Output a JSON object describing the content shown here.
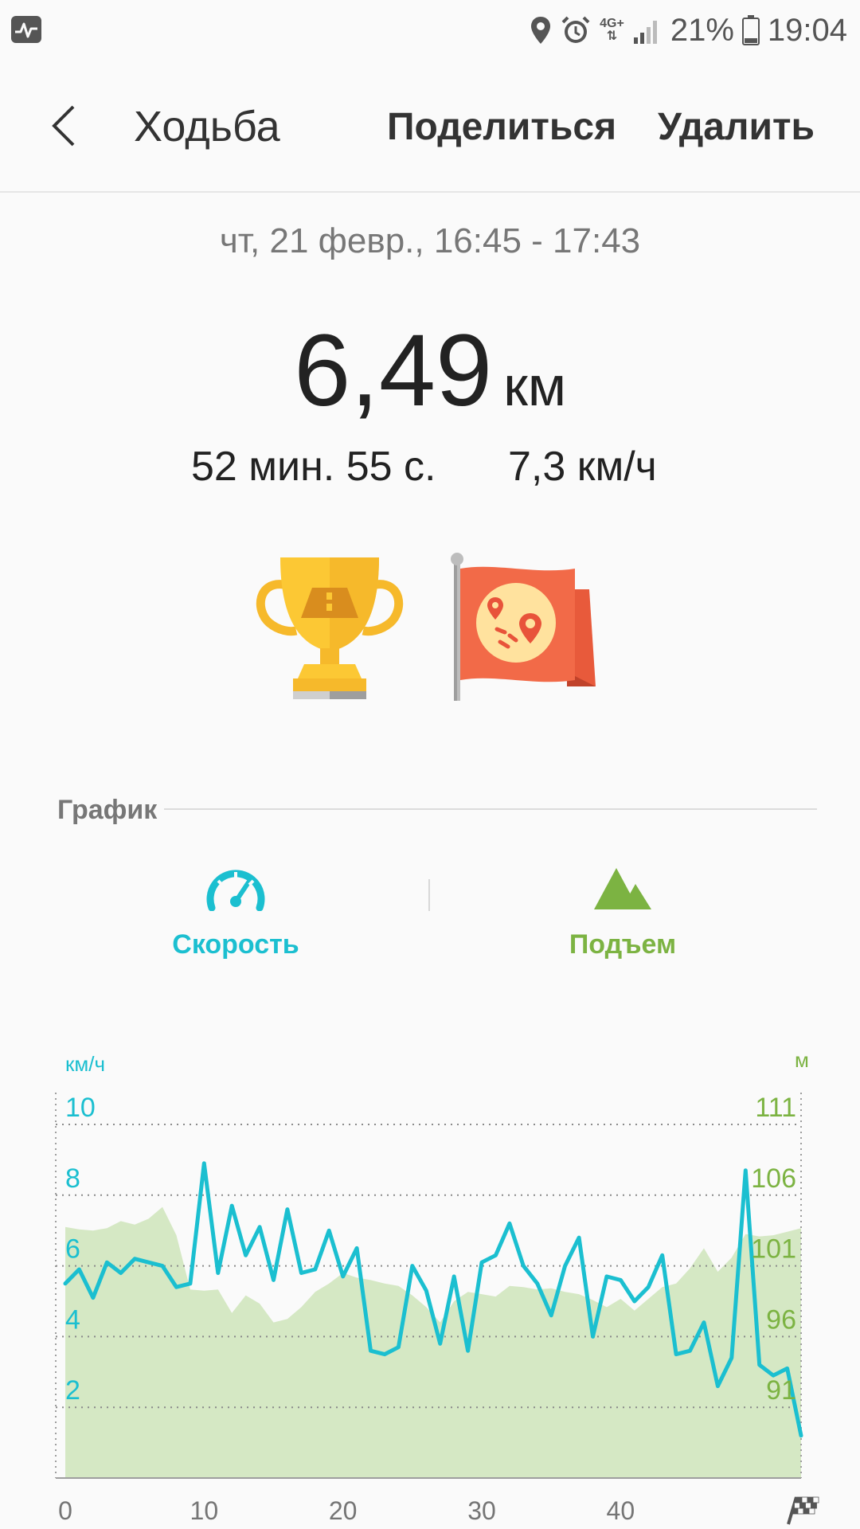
{
  "status_bar": {
    "network": "4G+",
    "battery": "21%",
    "time": "19:04"
  },
  "header": {
    "title": "Ходьба",
    "share_label": "Поделиться",
    "delete_label": "Удалить"
  },
  "summary": {
    "date_range": "чт, 21 февр., 16:45 - 17:43",
    "distance_value": "6,49",
    "distance_unit": "км",
    "duration": "52 мин. 55 с.",
    "avg_speed": "7,3 км/ч"
  },
  "section": {
    "title": "График"
  },
  "tabs": [
    {
      "label": "Скорость",
      "icon": "speedometer-icon",
      "color": "#1bbfd0"
    },
    {
      "label": "Подъем",
      "icon": "mountain-icon",
      "color": "#7cb342"
    }
  ],
  "colors": {
    "speed": "#1bbfd0",
    "elevation_line": "#7cb342",
    "elevation_fill": "#d5e8c4"
  },
  "chart_data": {
    "type": "line",
    "left_axis": {
      "label": "км/ч",
      "ticks": [
        "2",
        "4",
        "6",
        "8",
        "10"
      ],
      "ylim": [
        0,
        10
      ]
    },
    "right_axis": {
      "label": "м",
      "ticks": [
        "91",
        "96",
        "101",
        "106",
        "111"
      ],
      "ylim": [
        81,
        111
      ]
    },
    "x_ticks": [
      "0",
      "10",
      "20",
      "30",
      "40"
    ],
    "xlim": [
      0,
      53
    ],
    "grid": true,
    "series": [
      {
        "axis": "left",
        "x": [
          0,
          1,
          2,
          3,
          4,
          5,
          6,
          7,
          8,
          9,
          10,
          11,
          12,
          13,
          14,
          15,
          16,
          17,
          18,
          19,
          20,
          21,
          22,
          23,
          24,
          25,
          26,
          27,
          28,
          29,
          30,
          31,
          32,
          33,
          34,
          35,
          36,
          37,
          38,
          39,
          40,
          41,
          42,
          43,
          44,
          45,
          46,
          47,
          48,
          49,
          50,
          51,
          52,
          53
        ],
        "values": [
          5.5,
          5.9,
          5.1,
          6.1,
          5.8,
          6.2,
          6.1,
          6.0,
          5.4,
          5.5,
          8.9,
          5.8,
          7.7,
          6.3,
          7.1,
          5.6,
          7.6,
          5.8,
          5.9,
          7.0,
          5.7,
          6.5,
          3.6,
          3.5,
          3.7,
          6.0,
          5.3,
          3.8,
          5.7,
          3.6,
          6.1,
          6.3,
          7.2,
          6.0,
          5.5,
          4.6,
          6.0,
          6.8,
          4.0,
          5.7,
          5.6,
          5.0,
          5.4,
          6.3,
          3.5,
          3.6,
          4.4,
          2.6,
          3.4,
          8.7,
          3.2,
          2.9,
          3.1,
          1.2
        ]
      },
      {
        "axis": "right",
        "x": [
          0,
          1,
          2,
          3,
          4,
          5,
          6,
          7,
          8,
          9,
          10,
          11,
          12,
          13,
          14,
          15,
          16,
          17,
          18,
          19,
          20,
          21,
          22,
          23,
          24,
          25,
          26,
          27,
          28,
          29,
          30,
          31,
          32,
          33,
          34,
          35,
          36,
          37,
          38,
          39,
          40,
          41,
          42,
          43,
          44,
          45,
          46,
          47,
          48,
          49,
          50,
          51,
          52,
          53
        ],
        "values": [
          102.3,
          102.1,
          102.0,
          102.2,
          102.8,
          102.5,
          103.0,
          104.0,
          101.6,
          97.0,
          96.9,
          97.0,
          95.0,
          96.5,
          95.8,
          94.2,
          94.5,
          95.5,
          96.8,
          97.5,
          98.4,
          98.0,
          97.8,
          97.5,
          97.3,
          96.5,
          95.5,
          94.2,
          96.0,
          96.8,
          96.6,
          96.4,
          97.3,
          97.2,
          97.0,
          97.1,
          96.8,
          96.6,
          96.1,
          95.5,
          96.2,
          95.2,
          96.2,
          97.2,
          97.5,
          98.8,
          100.5,
          98.5,
          99.7,
          101.7,
          101.5,
          101.6,
          101.9,
          102.2
        ]
      }
    ]
  }
}
